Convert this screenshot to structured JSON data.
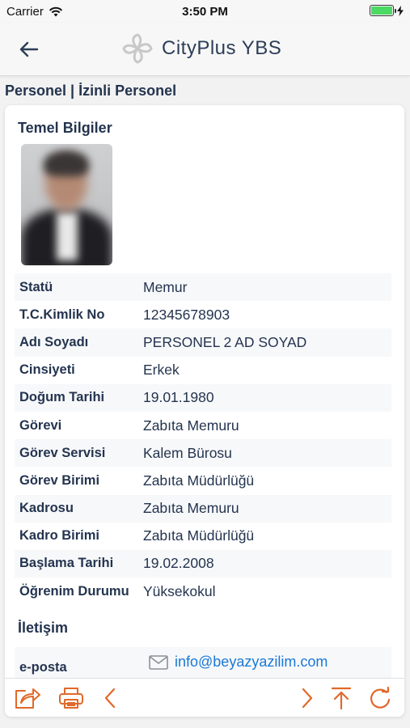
{
  "status_bar": {
    "carrier": "Carrier",
    "time": "3:50 PM",
    "battery_level": 1.0,
    "battery_color": "#4cd964"
  },
  "nav": {
    "title": "CityPlus YBS",
    "back_icon": "arrow-left-icon",
    "logo_icon": "cityplus-logo-icon"
  },
  "breadcrumb": "Personel | İzinli Personel",
  "basic_info": {
    "title": "Temel Bilgiler",
    "rows": [
      {
        "label": "Statü",
        "value": "Memur"
      },
      {
        "label": "T.C.Kimlik No",
        "value": "12345678903"
      },
      {
        "label": "Adı Soyadı",
        "value": "PERSONEL 2 AD SOYAD"
      },
      {
        "label": "Cinsiyeti",
        "value": "Erkek"
      },
      {
        "label": "Doğum Tarihi",
        "value": "19.01.1980"
      },
      {
        "label": "Görevi",
        "value": "Zabıta Memuru"
      },
      {
        "label": "Görev Servisi",
        "value": "Kalem Bürosu"
      },
      {
        "label": "Görev Birimi",
        "value": "Zabıta Müdürlüğü"
      },
      {
        "label": "Kadrosu",
        "value": "Zabıta Memuru"
      },
      {
        "label": "Kadro Birimi",
        "value": "Zabıta Müdürlüğü"
      },
      {
        "label": "Başlama Tarihi",
        "value": "19.02.2008"
      },
      {
        "label": "Öğrenim Durumu",
        "value": "Yüksekokul"
      }
    ]
  },
  "contact": {
    "title": "İletişim",
    "email_label": "e-posta",
    "email": "info@beyazyazilim.com"
  },
  "toolbar": {
    "accent_color": "#e0692a",
    "buttons": [
      "share-icon",
      "print-icon",
      "chevron-left-icon",
      "chevron-right-icon",
      "scroll-top-icon",
      "refresh-icon"
    ]
  }
}
